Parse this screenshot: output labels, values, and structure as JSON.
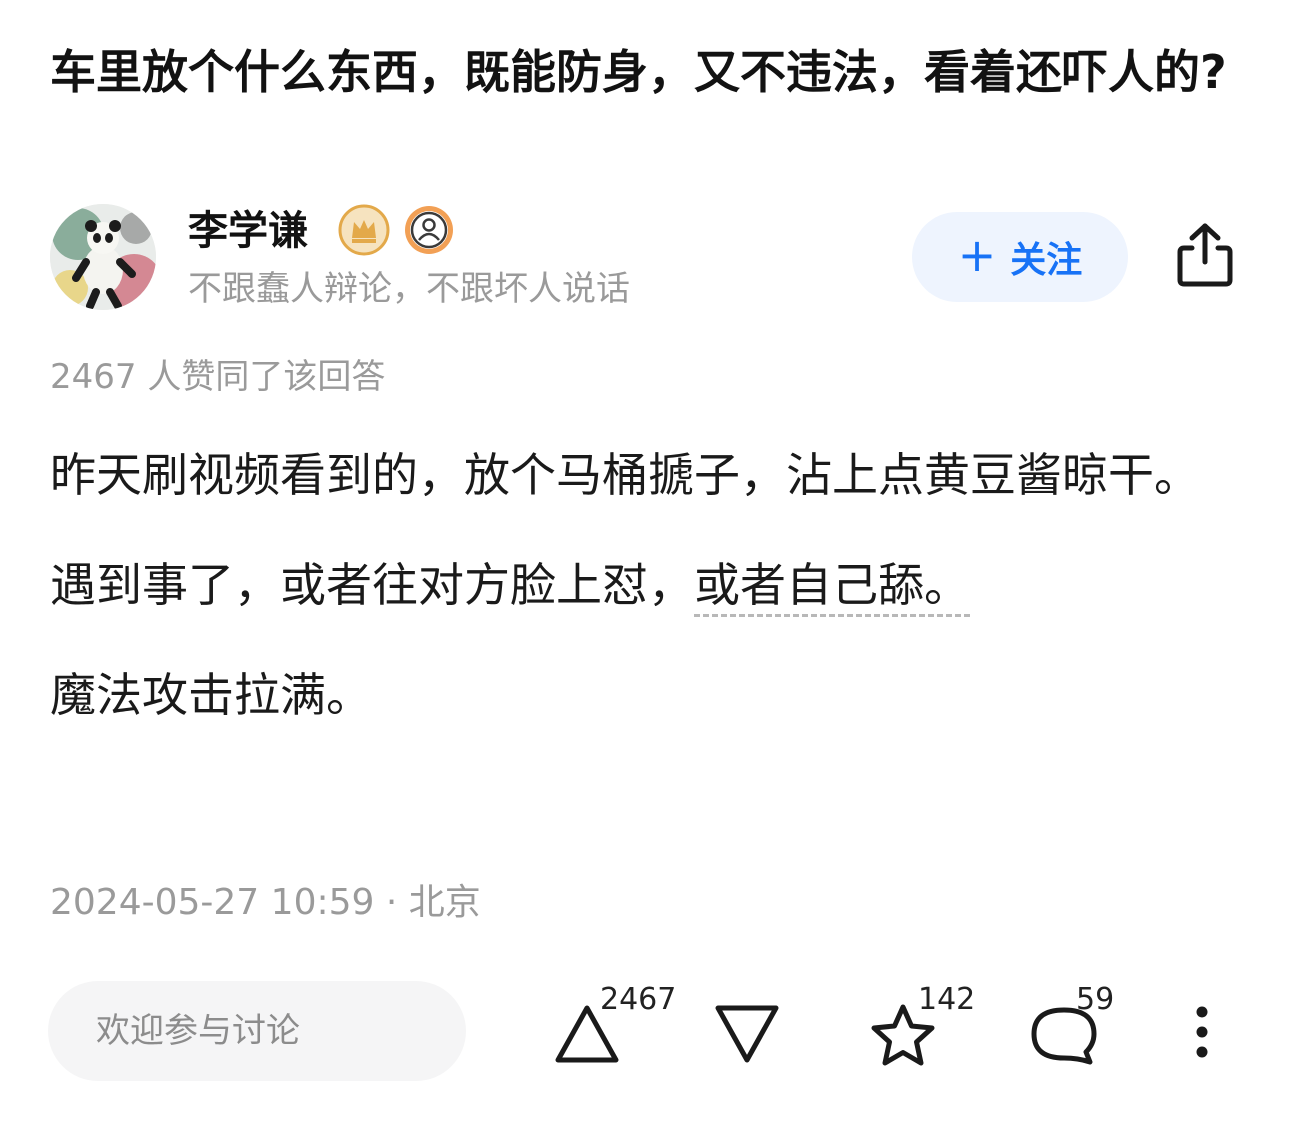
{
  "question": {
    "title": "车里放个什么东西，既能防身，又不违法，看着还吓人的?"
  },
  "author": {
    "name": "李学谦",
    "bio": "不跟蠢人辩论，不跟坏人说话",
    "badges": [
      "crown-badge-icon",
      "person-badge-icon"
    ]
  },
  "follow": {
    "plus": "+",
    "label": "关注"
  },
  "vote_summary": "2467 人赞同了该回答",
  "answer": {
    "paragraph_1": "昨天刷视频看到的，放个马桶搋子，沾上点黄豆酱晾干。",
    "paragraph_2_prefix": "遇到事了，或者往对方脸上怼，",
    "paragraph_2_underlined": "或者自己舔。",
    "paragraph_3": "魔法攻击拉满。"
  },
  "meta": "2024-05-27 10:59 · 北京",
  "comment_input": {
    "placeholder": "欢迎参与讨论"
  },
  "actions": {
    "upvote_count": "2467",
    "favorite_count": "142",
    "comment_count": "59"
  },
  "colors": {
    "accent": "#1772f6",
    "follow_bg": "#eef4fe",
    "muted_text": "#9a9a9a",
    "badge_gold": "#e3a94a"
  }
}
